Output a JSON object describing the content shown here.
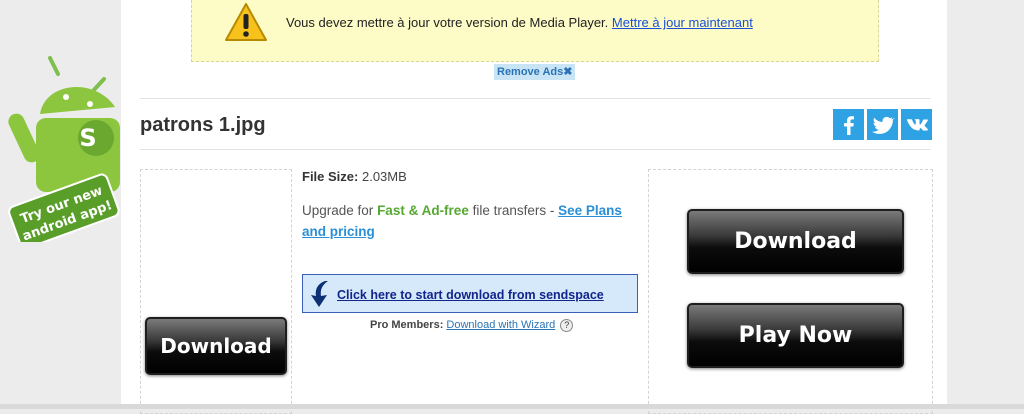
{
  "banner": {
    "message": "Vous devez mettre à jour votre version de Media Player.",
    "link": "Mettre à jour maintenant",
    "remove_ads": "Remove Ads"
  },
  "file": {
    "title": "patrons 1.jpg",
    "size_label": "File Size:",
    "size_value": "2.03MB"
  },
  "social": {
    "icons": [
      "facebook-icon",
      "twitter-icon",
      "vk-icon"
    ],
    "color": "#2fa2e4"
  },
  "upgrade": {
    "prefix": "Upgrade for",
    "highlight": "Fast & Ad-free",
    "middle": "file transfers -",
    "link": "See Plans and pricing"
  },
  "download_link": {
    "label": "Click here to start download from sendspace"
  },
  "pro": {
    "label": "Pro Members:",
    "link": "Download with Wizard",
    "help": "?"
  },
  "buttons": {
    "left_download": "Download",
    "right_download": "Download",
    "play_now": "Play Now"
  },
  "android_promo": {
    "line1": "Try our new",
    "line2": "android app!",
    "badge_letter": "S"
  }
}
